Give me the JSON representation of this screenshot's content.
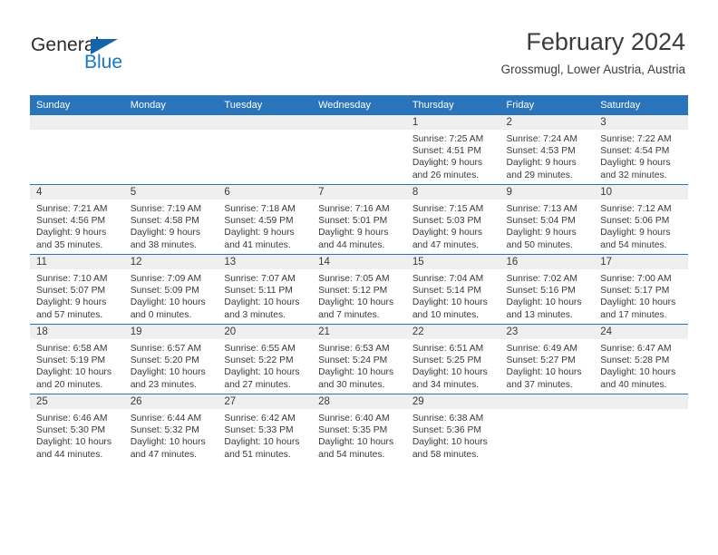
{
  "brand": {
    "name_part1": "General",
    "name_part2": "Blue",
    "triangle_icon": "triangle-icon",
    "accent_color": "#1878c8",
    "header_color": "#2a74bb"
  },
  "header": {
    "title": "February 2024",
    "subtitle": "Grossmugl, Lower Austria, Austria"
  },
  "calendar": {
    "weekday_headers": [
      "Sunday",
      "Monday",
      "Tuesday",
      "Wednesday",
      "Thursday",
      "Friday",
      "Saturday"
    ],
    "weeks": [
      [
        {
          "day": "",
          "lines": []
        },
        {
          "day": "",
          "lines": []
        },
        {
          "day": "",
          "lines": []
        },
        {
          "day": "",
          "lines": []
        },
        {
          "day": "1",
          "lines": [
            "Sunrise: 7:25 AM",
            "Sunset: 4:51 PM",
            "Daylight: 9 hours",
            "and 26 minutes."
          ]
        },
        {
          "day": "2",
          "lines": [
            "Sunrise: 7:24 AM",
            "Sunset: 4:53 PM",
            "Daylight: 9 hours",
            "and 29 minutes."
          ]
        },
        {
          "day": "3",
          "lines": [
            "Sunrise: 7:22 AM",
            "Sunset: 4:54 PM",
            "Daylight: 9 hours",
            "and 32 minutes."
          ]
        }
      ],
      [
        {
          "day": "4",
          "lines": [
            "Sunrise: 7:21 AM",
            "Sunset: 4:56 PM",
            "Daylight: 9 hours",
            "and 35 minutes."
          ]
        },
        {
          "day": "5",
          "lines": [
            "Sunrise: 7:19 AM",
            "Sunset: 4:58 PM",
            "Daylight: 9 hours",
            "and 38 minutes."
          ]
        },
        {
          "day": "6",
          "lines": [
            "Sunrise: 7:18 AM",
            "Sunset: 4:59 PM",
            "Daylight: 9 hours",
            "and 41 minutes."
          ]
        },
        {
          "day": "7",
          "lines": [
            "Sunrise: 7:16 AM",
            "Sunset: 5:01 PM",
            "Daylight: 9 hours",
            "and 44 minutes."
          ]
        },
        {
          "day": "8",
          "lines": [
            "Sunrise: 7:15 AM",
            "Sunset: 5:03 PM",
            "Daylight: 9 hours",
            "and 47 minutes."
          ]
        },
        {
          "day": "9",
          "lines": [
            "Sunrise: 7:13 AM",
            "Sunset: 5:04 PM",
            "Daylight: 9 hours",
            "and 50 minutes."
          ]
        },
        {
          "day": "10",
          "lines": [
            "Sunrise: 7:12 AM",
            "Sunset: 5:06 PM",
            "Daylight: 9 hours",
            "and 54 minutes."
          ]
        }
      ],
      [
        {
          "day": "11",
          "lines": [
            "Sunrise: 7:10 AM",
            "Sunset: 5:07 PM",
            "Daylight: 9 hours",
            "and 57 minutes."
          ]
        },
        {
          "day": "12",
          "lines": [
            "Sunrise: 7:09 AM",
            "Sunset: 5:09 PM",
            "Daylight: 10 hours",
            "and 0 minutes."
          ]
        },
        {
          "day": "13",
          "lines": [
            "Sunrise: 7:07 AM",
            "Sunset: 5:11 PM",
            "Daylight: 10 hours",
            "and 3 minutes."
          ]
        },
        {
          "day": "14",
          "lines": [
            "Sunrise: 7:05 AM",
            "Sunset: 5:12 PM",
            "Daylight: 10 hours",
            "and 7 minutes."
          ]
        },
        {
          "day": "15",
          "lines": [
            "Sunrise: 7:04 AM",
            "Sunset: 5:14 PM",
            "Daylight: 10 hours",
            "and 10 minutes."
          ]
        },
        {
          "day": "16",
          "lines": [
            "Sunrise: 7:02 AM",
            "Sunset: 5:16 PM",
            "Daylight: 10 hours",
            "and 13 minutes."
          ]
        },
        {
          "day": "17",
          "lines": [
            "Sunrise: 7:00 AM",
            "Sunset: 5:17 PM",
            "Daylight: 10 hours",
            "and 17 minutes."
          ]
        }
      ],
      [
        {
          "day": "18",
          "lines": [
            "Sunrise: 6:58 AM",
            "Sunset: 5:19 PM",
            "Daylight: 10 hours",
            "and 20 minutes."
          ]
        },
        {
          "day": "19",
          "lines": [
            "Sunrise: 6:57 AM",
            "Sunset: 5:20 PM",
            "Daylight: 10 hours",
            "and 23 minutes."
          ]
        },
        {
          "day": "20",
          "lines": [
            "Sunrise: 6:55 AM",
            "Sunset: 5:22 PM",
            "Daylight: 10 hours",
            "and 27 minutes."
          ]
        },
        {
          "day": "21",
          "lines": [
            "Sunrise: 6:53 AM",
            "Sunset: 5:24 PM",
            "Daylight: 10 hours",
            "and 30 minutes."
          ]
        },
        {
          "day": "22",
          "lines": [
            "Sunrise: 6:51 AM",
            "Sunset: 5:25 PM",
            "Daylight: 10 hours",
            "and 34 minutes."
          ]
        },
        {
          "day": "23",
          "lines": [
            "Sunrise: 6:49 AM",
            "Sunset: 5:27 PM",
            "Daylight: 10 hours",
            "and 37 minutes."
          ]
        },
        {
          "day": "24",
          "lines": [
            "Sunrise: 6:47 AM",
            "Sunset: 5:28 PM",
            "Daylight: 10 hours",
            "and 40 minutes."
          ]
        }
      ],
      [
        {
          "day": "25",
          "lines": [
            "Sunrise: 6:46 AM",
            "Sunset: 5:30 PM",
            "Daylight: 10 hours",
            "and 44 minutes."
          ]
        },
        {
          "day": "26",
          "lines": [
            "Sunrise: 6:44 AM",
            "Sunset: 5:32 PM",
            "Daylight: 10 hours",
            "and 47 minutes."
          ]
        },
        {
          "day": "27",
          "lines": [
            "Sunrise: 6:42 AM",
            "Sunset: 5:33 PM",
            "Daylight: 10 hours",
            "and 51 minutes."
          ]
        },
        {
          "day": "28",
          "lines": [
            "Sunrise: 6:40 AM",
            "Sunset: 5:35 PM",
            "Daylight: 10 hours",
            "and 54 minutes."
          ]
        },
        {
          "day": "29",
          "lines": [
            "Sunrise: 6:38 AM",
            "Sunset: 5:36 PM",
            "Daylight: 10 hours",
            "and 58 minutes."
          ]
        },
        {
          "day": "",
          "lines": []
        },
        {
          "day": "",
          "lines": []
        }
      ]
    ]
  }
}
